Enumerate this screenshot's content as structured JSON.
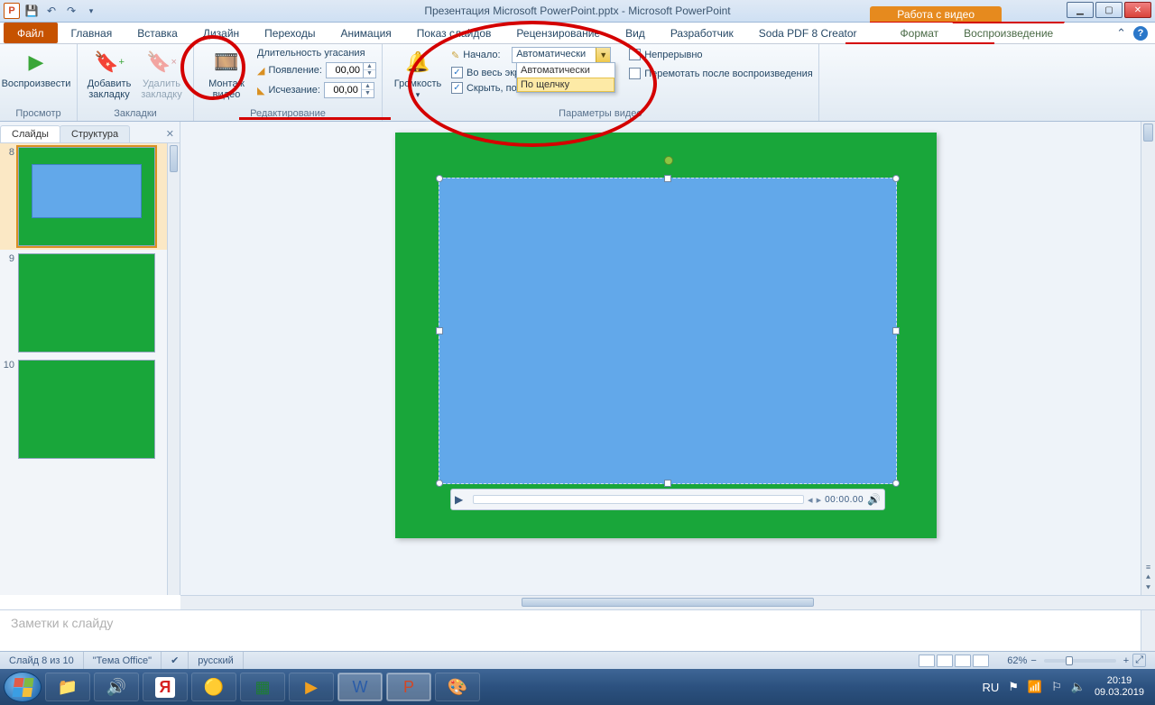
{
  "title": "Презентация Microsoft PowerPoint.pptx - Microsoft PowerPoint",
  "context_tab": "Работа с видео",
  "tabs": {
    "file": "Файл",
    "home": "Главная",
    "insert": "Вставка",
    "design": "Дизайн",
    "transitions": "Переходы",
    "animations": "Анимация",
    "slideshow": "Показ слайдов",
    "review": "Рецензирование",
    "view": "Вид",
    "developer": "Разработчик",
    "soda": "Soda PDF 8 Creator",
    "format": "Формат",
    "playback": "Воспроизведение"
  },
  "groups": {
    "preview": {
      "label": "Просмотр",
      "play": "Воспроизвести"
    },
    "bookmarks": {
      "label": "Закладки",
      "add": "Добавить закладку",
      "remove": "Удалить закладку"
    },
    "editing": {
      "label": "Редактирование",
      "trim": "Монтаж видео",
      "fade_title": "Длительность угасания",
      "fade_in_lbl": "Появление:",
      "fade_in_val": "00,00",
      "fade_out_lbl": "Исчезание:",
      "fade_out_val": "00,00"
    },
    "options": {
      "label": "Параметры видео",
      "volume": "Громкость",
      "start_lbl": "Начало:",
      "start_val": "Автоматически",
      "fullscreen": "Во весь экран",
      "hide": "Скрыть, пока не",
      "loop": "Непрерывно",
      "rewind": "Перемотать после воспроизведения",
      "dd1": "Автоматически",
      "dd2": "По щелчку"
    }
  },
  "slidenav": {
    "tab1": "Слайды",
    "tab2": "Структура",
    "slides": [
      {
        "num": "8",
        "sel": true,
        "blue": true
      },
      {
        "num": "9",
        "sel": false,
        "blue": false
      },
      {
        "num": "10",
        "sel": false,
        "blue": false
      }
    ]
  },
  "notes_placeholder": "Заметки к слайду",
  "status": {
    "pos": "Слайд 8 из 10",
    "theme": "\"Тема Office\"",
    "lang": "русский",
    "zoom": "62%"
  },
  "videobar_time": "00:00.00",
  "tray": {
    "lang": "RU",
    "time": "20:19",
    "date": "09.03.2019"
  }
}
